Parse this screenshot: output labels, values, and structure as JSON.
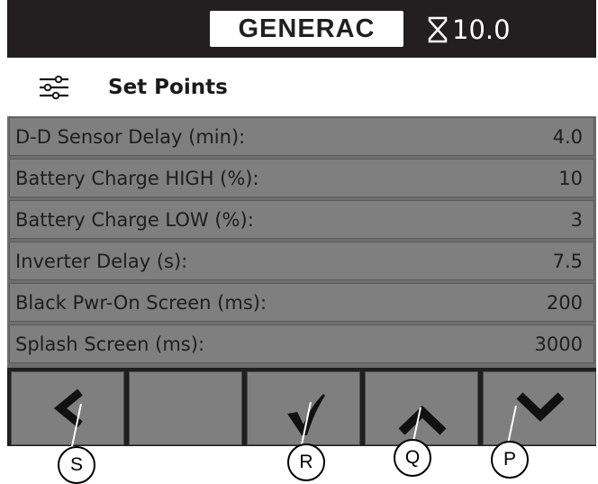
{
  "header": {
    "brand": "GENERAC",
    "timer_value": "10.0",
    "timer_icon": "hourglass-icon"
  },
  "page": {
    "title": "Set Points",
    "icon": "sliders-icon"
  },
  "rows": [
    {
      "label": "D-D Sensor Delay (min):",
      "value": "4.0"
    },
    {
      "label": "Battery Charge HIGH (%):",
      "value": "10"
    },
    {
      "label": "Battery Charge LOW (%):",
      "value": "3"
    },
    {
      "label": "Inverter Delay (s):",
      "value": "7.5"
    },
    {
      "label": "Black Pwr-On Screen (ms):",
      "value": "200"
    },
    {
      "label": "Splash Screen (ms):",
      "value": "3000"
    }
  ],
  "buttons": [
    {
      "icon": "chevron-left-icon"
    },
    {
      "icon": "blank"
    },
    {
      "icon": "checkmark-icon"
    },
    {
      "icon": "chevron-up-icon"
    },
    {
      "icon": "chevron-down-icon"
    }
  ],
  "callouts": {
    "s": "S",
    "r": "R",
    "q": "Q",
    "p": "P"
  },
  "colors": {
    "screen_bg": "#1f1f1f",
    "row_bg": "#7f7f7f",
    "header_bg": "#231f20"
  }
}
